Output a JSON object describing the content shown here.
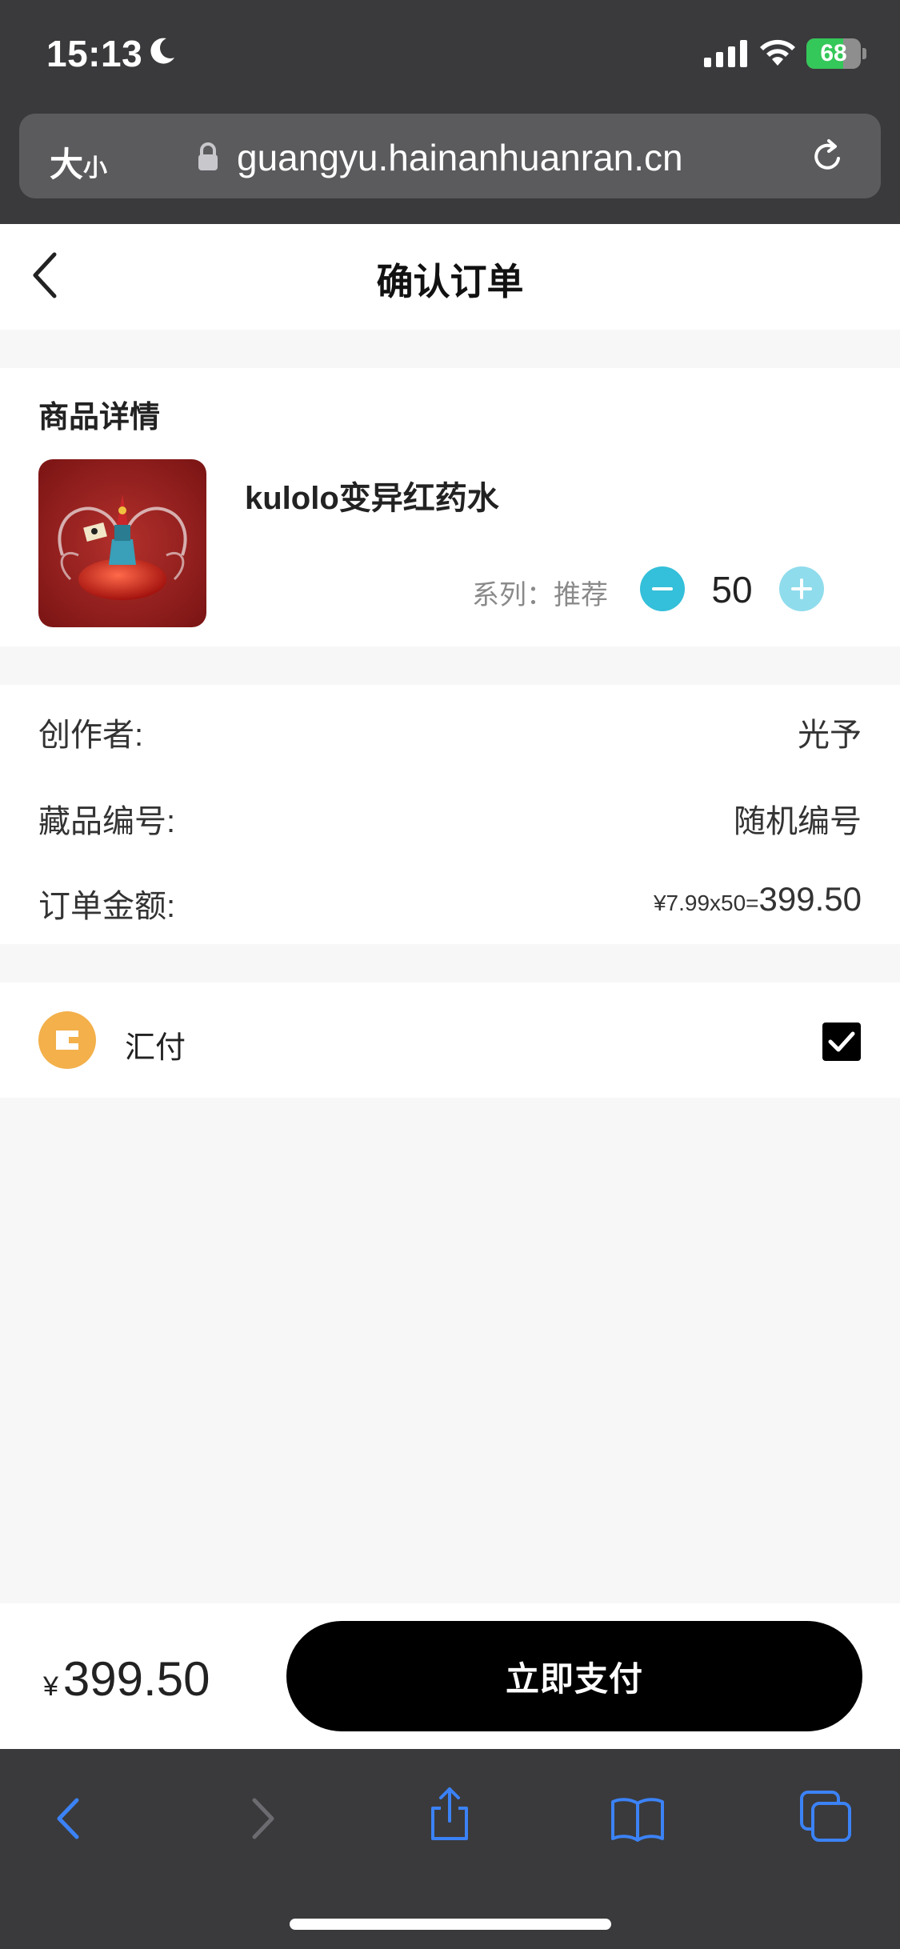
{
  "status_bar": {
    "time": "15:13",
    "battery": "68",
    "battery_level": 0.68
  },
  "url_bar": {
    "size_big": "大",
    "size_small": "小",
    "url": "guangyu.hainanhuanran.cn"
  },
  "header": {
    "title": "确认订单"
  },
  "product_section": {
    "title": "商品详情",
    "name": "kulolo变异红药水",
    "series": "系列：推荐",
    "quantity": "50"
  },
  "info": {
    "creator_label": "创作者:",
    "creator_value": "光予",
    "number_label": "藏品编号:",
    "number_value": "随机编号",
    "amount_label": "订单金额:",
    "amount_formula": "¥7.99x50=",
    "amount_value": "399.50"
  },
  "payment": {
    "method": "汇付",
    "selected": true
  },
  "bottom": {
    "currency": "¥",
    "total": "399.50",
    "pay_button": "立即支付"
  },
  "colors": {
    "accent": "#34bfda",
    "pay_icon": "#f3b04b",
    "battery_green": "#34c759",
    "safari_blue": "#3b82f6"
  },
  "icons": [
    "moon-icon",
    "signal-icon",
    "wifi-icon",
    "battery-icon",
    "lock-icon",
    "reload-icon",
    "back-chevron-icon",
    "wallet-icon",
    "checkbox-check-icon",
    "safari-back-icon",
    "safari-forward-icon",
    "share-icon",
    "bookmarks-icon",
    "tabs-icon"
  ]
}
